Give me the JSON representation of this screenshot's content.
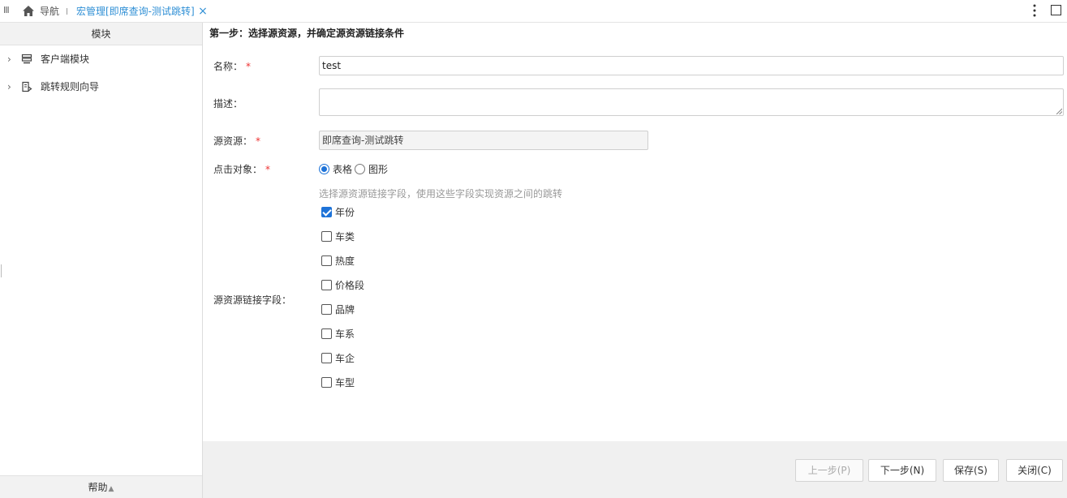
{
  "topbar": {
    "menu_glyph": "III",
    "nav_label": "导航",
    "tab_title": "宏管理[即席查询-测试跳转]",
    "close_glyph": "×"
  },
  "sidebar": {
    "header": "模块",
    "items": [
      {
        "label": "客户端模块",
        "icon": "module-icon"
      },
      {
        "label": "跳转规则向导",
        "icon": "wizard-icon"
      }
    ],
    "footer": "帮助",
    "footer_glyph": "▲"
  },
  "main": {
    "step_title": "第一步：选择源资源，并确定源资源链接条件",
    "name_label": "名称：",
    "name_value": "test",
    "desc_label": "描述：",
    "desc_value": "",
    "source_label": "源资源：",
    "source_value": "即席查询-测试跳转",
    "click_label": "点击对象：",
    "click_options": [
      {
        "label": "表格",
        "checked": true
      },
      {
        "label": "图形",
        "checked": false
      }
    ],
    "hint": "选择源资源链接字段，使用这些字段实现资源之间的跳转",
    "link_fields_label": "源资源链接字段：",
    "link_fields": [
      {
        "label": "年份",
        "checked": true
      },
      {
        "label": "车类",
        "checked": false
      },
      {
        "label": "热度",
        "checked": false
      },
      {
        "label": "价格段",
        "checked": false
      },
      {
        "label": "品牌",
        "checked": false
      },
      {
        "label": "车系",
        "checked": false
      },
      {
        "label": "车企",
        "checked": false
      },
      {
        "label": "车型",
        "checked": false
      }
    ],
    "required_mark": "*"
  },
  "buttons": {
    "prev": "上一步(P)",
    "next": "下一步(N)",
    "save": "保存(S)",
    "close": "关闭(C)"
  },
  "colors": {
    "accent": "#1e73d8",
    "tab_text": "#2f8fd5",
    "required": "#ee3333"
  }
}
